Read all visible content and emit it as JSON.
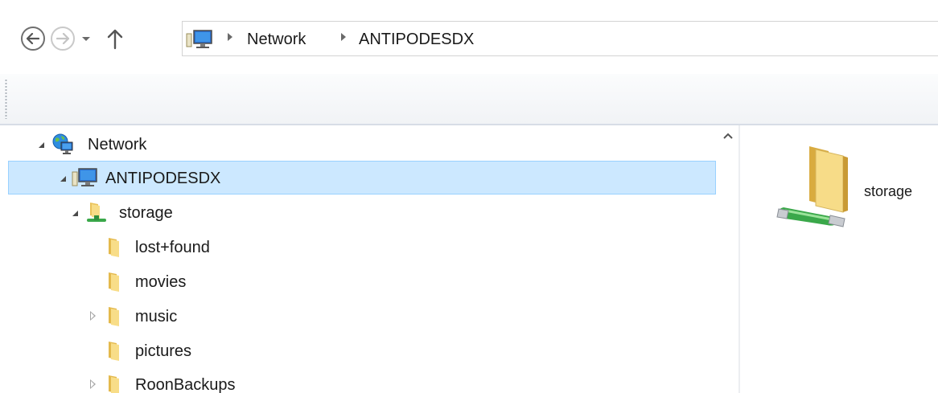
{
  "nav": {
    "back_icon": "back-arrow-icon",
    "forward_icon": "forward-arrow-icon",
    "recent_icon": "chevron-down-icon",
    "up_icon": "up-arrow-icon"
  },
  "address": {
    "root_icon": "computer-network-icon",
    "crumbs": [
      "Network",
      "ANTIPODESDX"
    ]
  },
  "tree": {
    "items": [
      {
        "label": "Network",
        "icon": "network-globe-icon",
        "expander": "expanded"
      },
      {
        "label": "ANTIPODESDX",
        "icon": "computer-icon",
        "expander": "expanded",
        "selected": true
      },
      {
        "label": "storage",
        "icon": "shared-folder-icon",
        "expander": "expanded"
      },
      {
        "label": "lost+found",
        "icon": "folder-icon",
        "expander": "none"
      },
      {
        "label": "movies",
        "icon": "folder-icon",
        "expander": "none"
      },
      {
        "label": "music",
        "icon": "folder-icon",
        "expander": "collapsed"
      },
      {
        "label": "pictures",
        "icon": "folder-icon",
        "expander": "none"
      },
      {
        "label": "RoonBackups",
        "icon": "folder-icon",
        "expander": "collapsed"
      }
    ]
  },
  "content": {
    "items": [
      {
        "label": "storage",
        "icon": "network-share-folder-icon"
      }
    ]
  },
  "colors": {
    "selection_bg": "#cce8ff",
    "selection_border": "#99d1ff",
    "folder_yellow": "#f5d77a",
    "share_green": "#3aa84a"
  }
}
